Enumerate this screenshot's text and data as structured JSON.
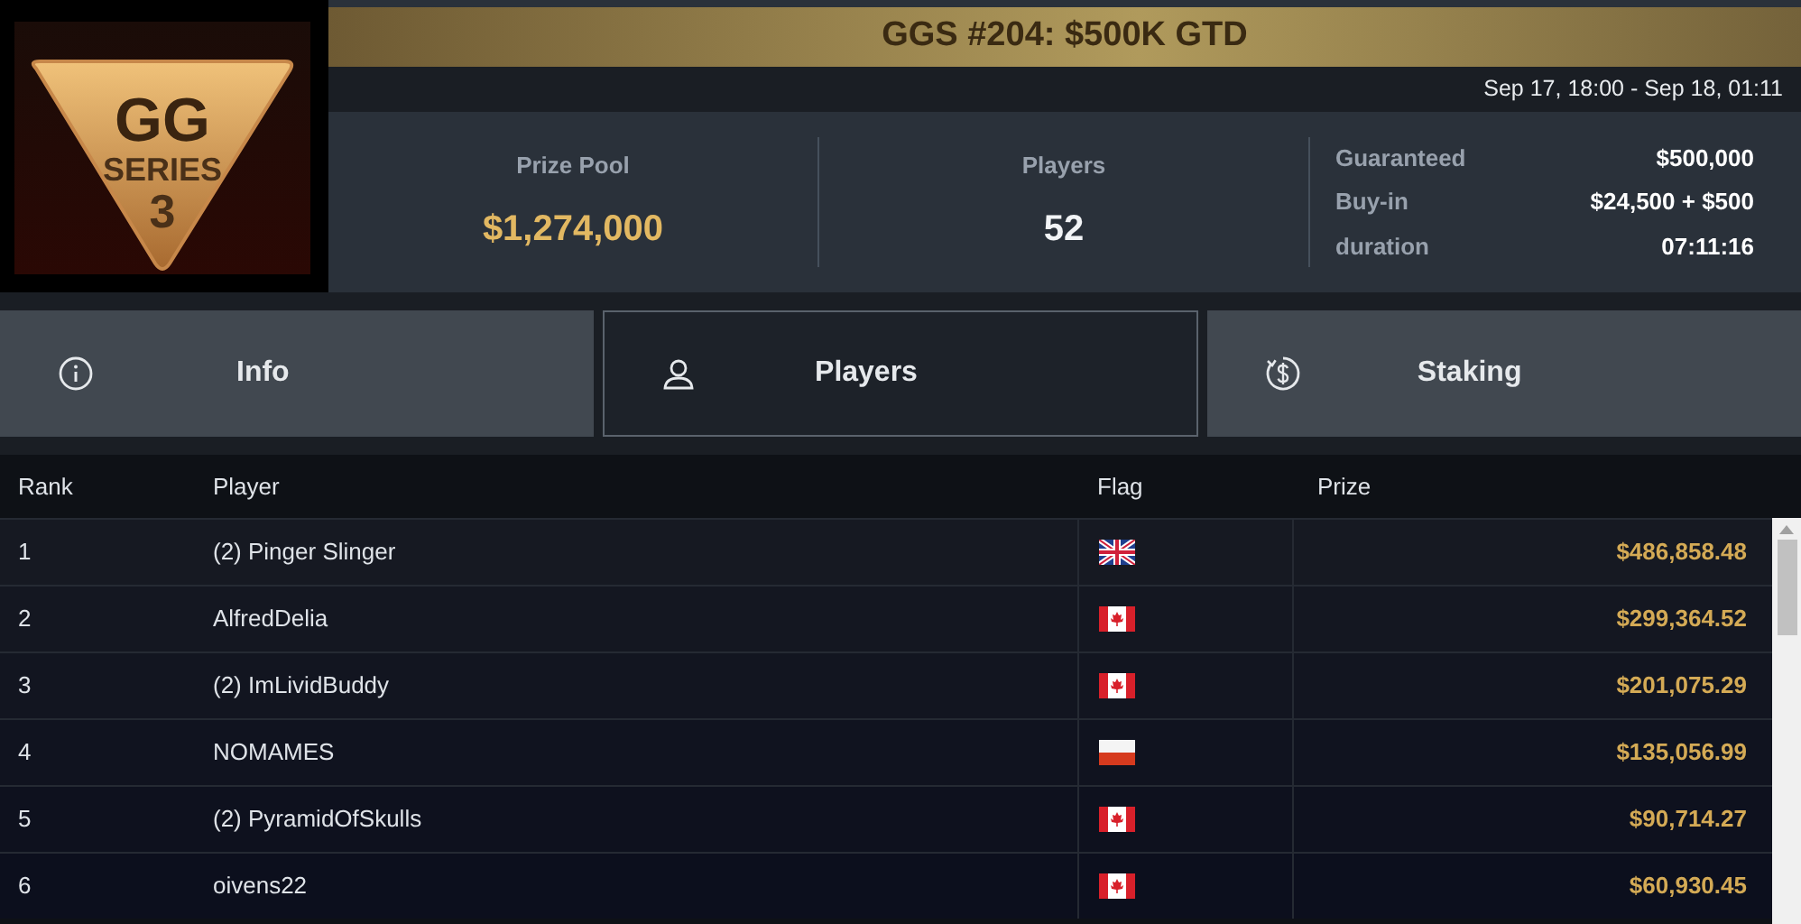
{
  "logo": {
    "mark": "GG",
    "line": "SERIES",
    "number": "3"
  },
  "title": "GGS #204: $500K GTD",
  "dates": "Sep 17, 18:00 - Sep 18, 01:11",
  "stats": [
    {
      "label": "Prize Pool",
      "value": "$1,274,000",
      "kind": "money"
    },
    {
      "label": "Players",
      "value": "52",
      "kind": "count"
    }
  ],
  "details": [
    {
      "label": "Guaranteed",
      "value": "$500,000"
    },
    {
      "label": "Buy-in",
      "value": "$24,500 + $500"
    },
    {
      "label": "duration",
      "value": "07:11:16"
    }
  ],
  "tabs": [
    {
      "label": "Info",
      "kind": "info",
      "selected": false
    },
    {
      "label": "Players",
      "kind": "person",
      "selected": true
    },
    {
      "label": "Staking",
      "kind": "dollar",
      "selected": false
    }
  ],
  "table": {
    "columns": [
      "Rank",
      "Player",
      "Flag",
      "Prize"
    ],
    "rows": [
      {
        "rank": "1",
        "player": "(2) Pinger Slinger",
        "kind": "uk",
        "prize": "$486,858.48"
      },
      {
        "rank": "2",
        "player": "AlfredDelia",
        "kind": "ca",
        "prize": "$299,364.52"
      },
      {
        "rank": "3",
        "player": "(2) ImLividBuddy",
        "kind": "ca",
        "prize": "$201,075.29"
      },
      {
        "rank": "4",
        "player": "NOMAMES",
        "kind": "pl",
        "prize": "$135,056.99"
      },
      {
        "rank": "5",
        "player": "(2) PyramidOfSkulls",
        "kind": "ca",
        "prize": "$90,714.27"
      },
      {
        "rank": "6",
        "player": "oivens22",
        "kind": "ca",
        "prize": "$60,930.45"
      }
    ]
  }
}
